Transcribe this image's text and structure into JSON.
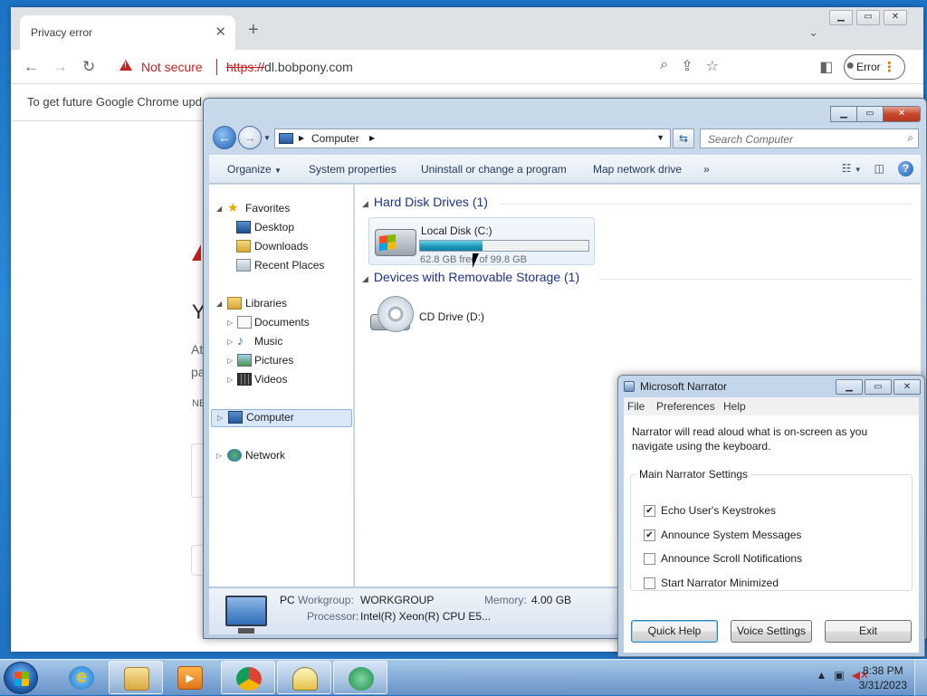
{
  "chrome": {
    "tab_title": "Privacy error",
    "not_secure": "Not secure",
    "url_scheme": "https://",
    "url_host": "dl.bobpony.com",
    "error_label": "Error",
    "infobar_text": "To get future Google Chrome upd",
    "page_fragments": [
      "Y",
      "At",
      "pa",
      "NE"
    ]
  },
  "explorer": {
    "breadcrumb": "Computer",
    "search_placeholder": "Search Computer",
    "toolbar": {
      "organize": "Organize",
      "system_properties": "System properties",
      "uninstall": "Uninstall or change a program",
      "map_drive": "Map network drive",
      "more": "»"
    },
    "nav": {
      "favorites": "Favorites",
      "desktop": "Desktop",
      "downloads": "Downloads",
      "recent_places": "Recent Places",
      "libraries": "Libraries",
      "documents": "Documents",
      "music": "Music",
      "pictures": "Pictures",
      "videos": "Videos",
      "computer": "Computer",
      "network": "Network"
    },
    "groups": {
      "hard_disks": "Hard Disk Drives (1)",
      "removable": "Devices with Removable Storage (1)"
    },
    "local_disk": {
      "name": "Local Disk (C:)",
      "free_text": "62.8 GB free of 99.8 GB",
      "used_fraction": 0.37
    },
    "cd_drive": "CD Drive (D:)",
    "details": {
      "pc_name": "PC",
      "workgroup_label": "Workgroup:",
      "workgroup_value": "WORKGROUP",
      "memory_label": "Memory:",
      "memory_value": "4.00 GB",
      "processor_label": "Processor:",
      "processor_value": "Intel(R) Xeon(R) CPU E5..."
    }
  },
  "narrator": {
    "title": "Microsoft Narrator",
    "menu": [
      "File",
      "Preferences",
      "Help"
    ],
    "description": "Narrator will read aloud what is on-screen as you navigate using the keyboard.",
    "settings_legend": "Main Narrator Settings",
    "options": [
      {
        "label": "Echo User's Keystrokes",
        "checked": true
      },
      {
        "label": "Announce System Messages",
        "checked": true
      },
      {
        "label": "Announce Scroll Notifications",
        "checked": false
      },
      {
        "label": "Start Narrator Minimized",
        "checked": false
      }
    ],
    "buttons": {
      "quick_help": "Quick Help",
      "voice_settings": "Voice Settings",
      "exit": "Exit"
    }
  },
  "taskbar": {
    "time": "8:38 PM",
    "date": "3/31/2023"
  }
}
